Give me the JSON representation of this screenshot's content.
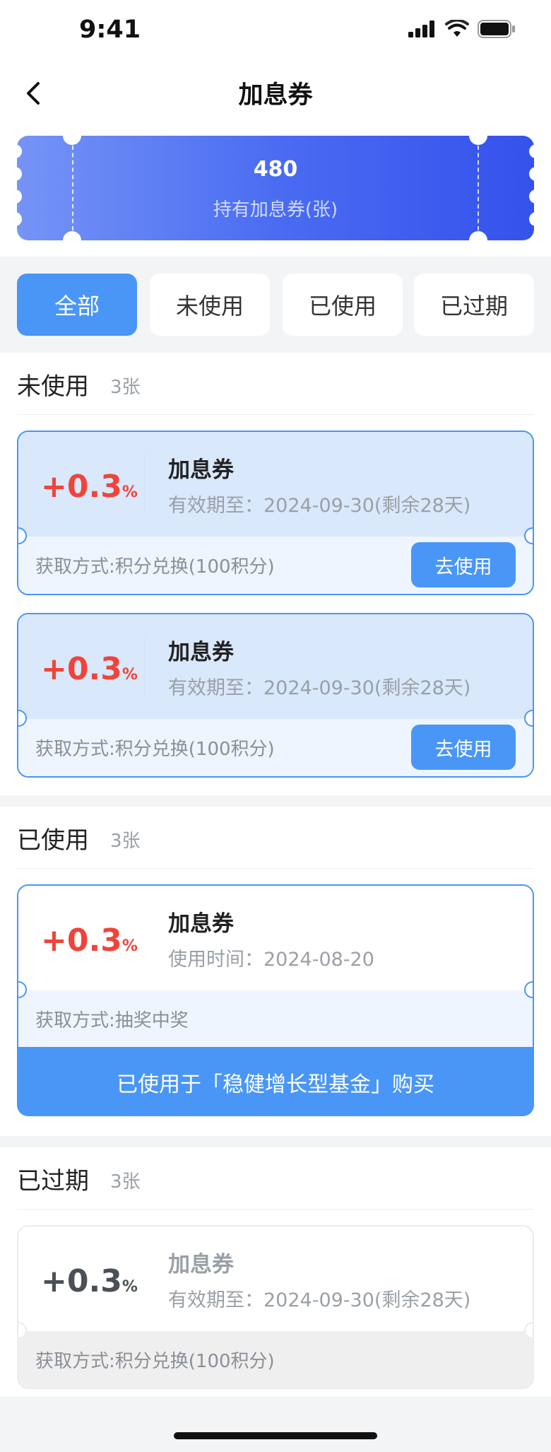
{
  "status": {
    "time": "9:41"
  },
  "nav": {
    "title": "加息券"
  },
  "banner": {
    "count": "480",
    "label": "持有加息券(张)"
  },
  "tabs": [
    {
      "label": "全部",
      "active": true
    },
    {
      "label": "未使用",
      "active": false
    },
    {
      "label": "已使用",
      "active": false
    },
    {
      "label": "已过期",
      "active": false
    }
  ],
  "sections": {
    "unused": {
      "title": "未使用",
      "count": "3张",
      "coupons": [
        {
          "rate": "+0.3",
          "unit": "%",
          "name": "加息券",
          "date": "有效期至：2024-09-30(剩余28天)",
          "source": "获取方式:积分兑换(100积分)",
          "button": "去使用"
        },
        {
          "rate": "+0.3",
          "unit": "%",
          "name": "加息券",
          "date": "有效期至：2024-09-30(剩余28天)",
          "source": "获取方式:积分兑换(100积分)",
          "button": "去使用"
        }
      ]
    },
    "used": {
      "title": "已使用",
      "count": "3张",
      "coupons": [
        {
          "rate": "+0.3",
          "unit": "%",
          "name": "加息券",
          "date": "使用时间：2024-08-20",
          "source": "获取方式:抽奖中奖",
          "footer": "已使用于「稳健增长型基金」购买"
        }
      ]
    },
    "expired": {
      "title": "已过期",
      "count": "3张",
      "coupons": [
        {
          "rate": "+0.3",
          "unit": "%",
          "name": "加息券",
          "date": "有效期至：2024-09-30(剩余28天)",
          "source": "获取方式:积分兑换(100积分)"
        }
      ]
    }
  },
  "colors": {
    "primary": "#4996f6",
    "red": "#f0443a",
    "banner_start": "#7694f6",
    "banner_end": "#3552ec"
  },
  "icons": [
    "back-icon",
    "signal-icon",
    "wifi-icon",
    "battery-icon"
  ]
}
